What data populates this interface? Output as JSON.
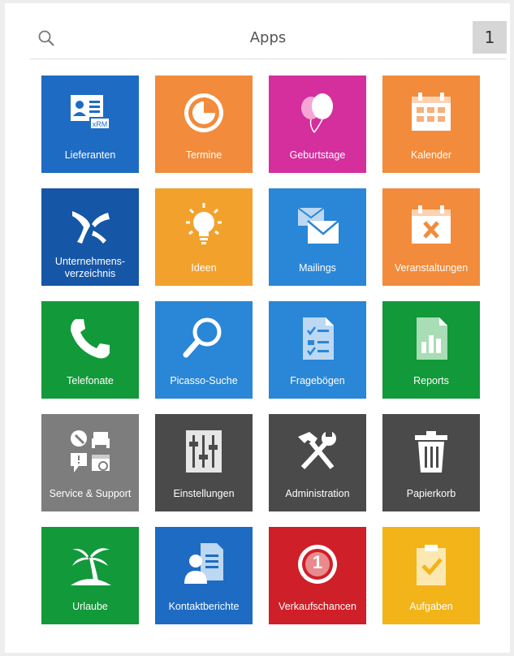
{
  "header": {
    "title": "Apps",
    "badge": "1"
  },
  "tiles": [
    {
      "label": "Lieferanten",
      "icon": "contact-card-icon",
      "color": "#1e6bc4"
    },
    {
      "label": "Termine",
      "icon": "target-icon",
      "color": "#f28b3b"
    },
    {
      "label": "Geburtstage",
      "icon": "balloons-icon",
      "color": "#d42f9c"
    },
    {
      "label": "Kalender",
      "icon": "calendar-icon",
      "color": "#f28b3b"
    },
    {
      "label": "Unternehmens-\nverzeichnis",
      "icon": "company-directory-icon",
      "color": "#1656a7"
    },
    {
      "label": "Ideen",
      "icon": "lightbulb-icon",
      "color": "#f2a22c"
    },
    {
      "label": "Mailings",
      "icon": "envelopes-icon",
      "color": "#2a86d6"
    },
    {
      "label": "Veranstaltungen",
      "icon": "calendar-cancel-icon",
      "color": "#f28b3b"
    },
    {
      "label": "Telefonate",
      "icon": "phone-icon",
      "color": "#12993a"
    },
    {
      "label": "Picasso-Suche",
      "icon": "magnifier-icon",
      "color": "#2a86d6"
    },
    {
      "label": "Fragebögen",
      "icon": "questionnaire-icon",
      "color": "#2a86d6"
    },
    {
      "label": "Reports",
      "icon": "report-chart-icon",
      "color": "#12993a"
    },
    {
      "label": "Service & Support",
      "icon": "service-support-icon",
      "color": "#7d7d7d"
    },
    {
      "label": "Einstellungen",
      "icon": "sliders-icon",
      "color": "#4a4a4a"
    },
    {
      "label": "Administration",
      "icon": "hammer-wrench-icon",
      "color": "#4a4a4a"
    },
    {
      "label": "Papierkorb",
      "icon": "trash-icon",
      "color": "#4a4a4a"
    },
    {
      "label": "Urlaube",
      "icon": "palm-tree-icon",
      "color": "#12993a"
    },
    {
      "label": "Kontaktberichte",
      "icon": "contact-report-icon",
      "color": "#1e6bc4"
    },
    {
      "label": "Verkaufschancen",
      "icon": "sales-opportunity-icon",
      "color": "#cf1f28",
      "count": "1"
    },
    {
      "label": "Aufgaben",
      "icon": "task-clipboard-icon",
      "color": "#f3b419"
    }
  ]
}
